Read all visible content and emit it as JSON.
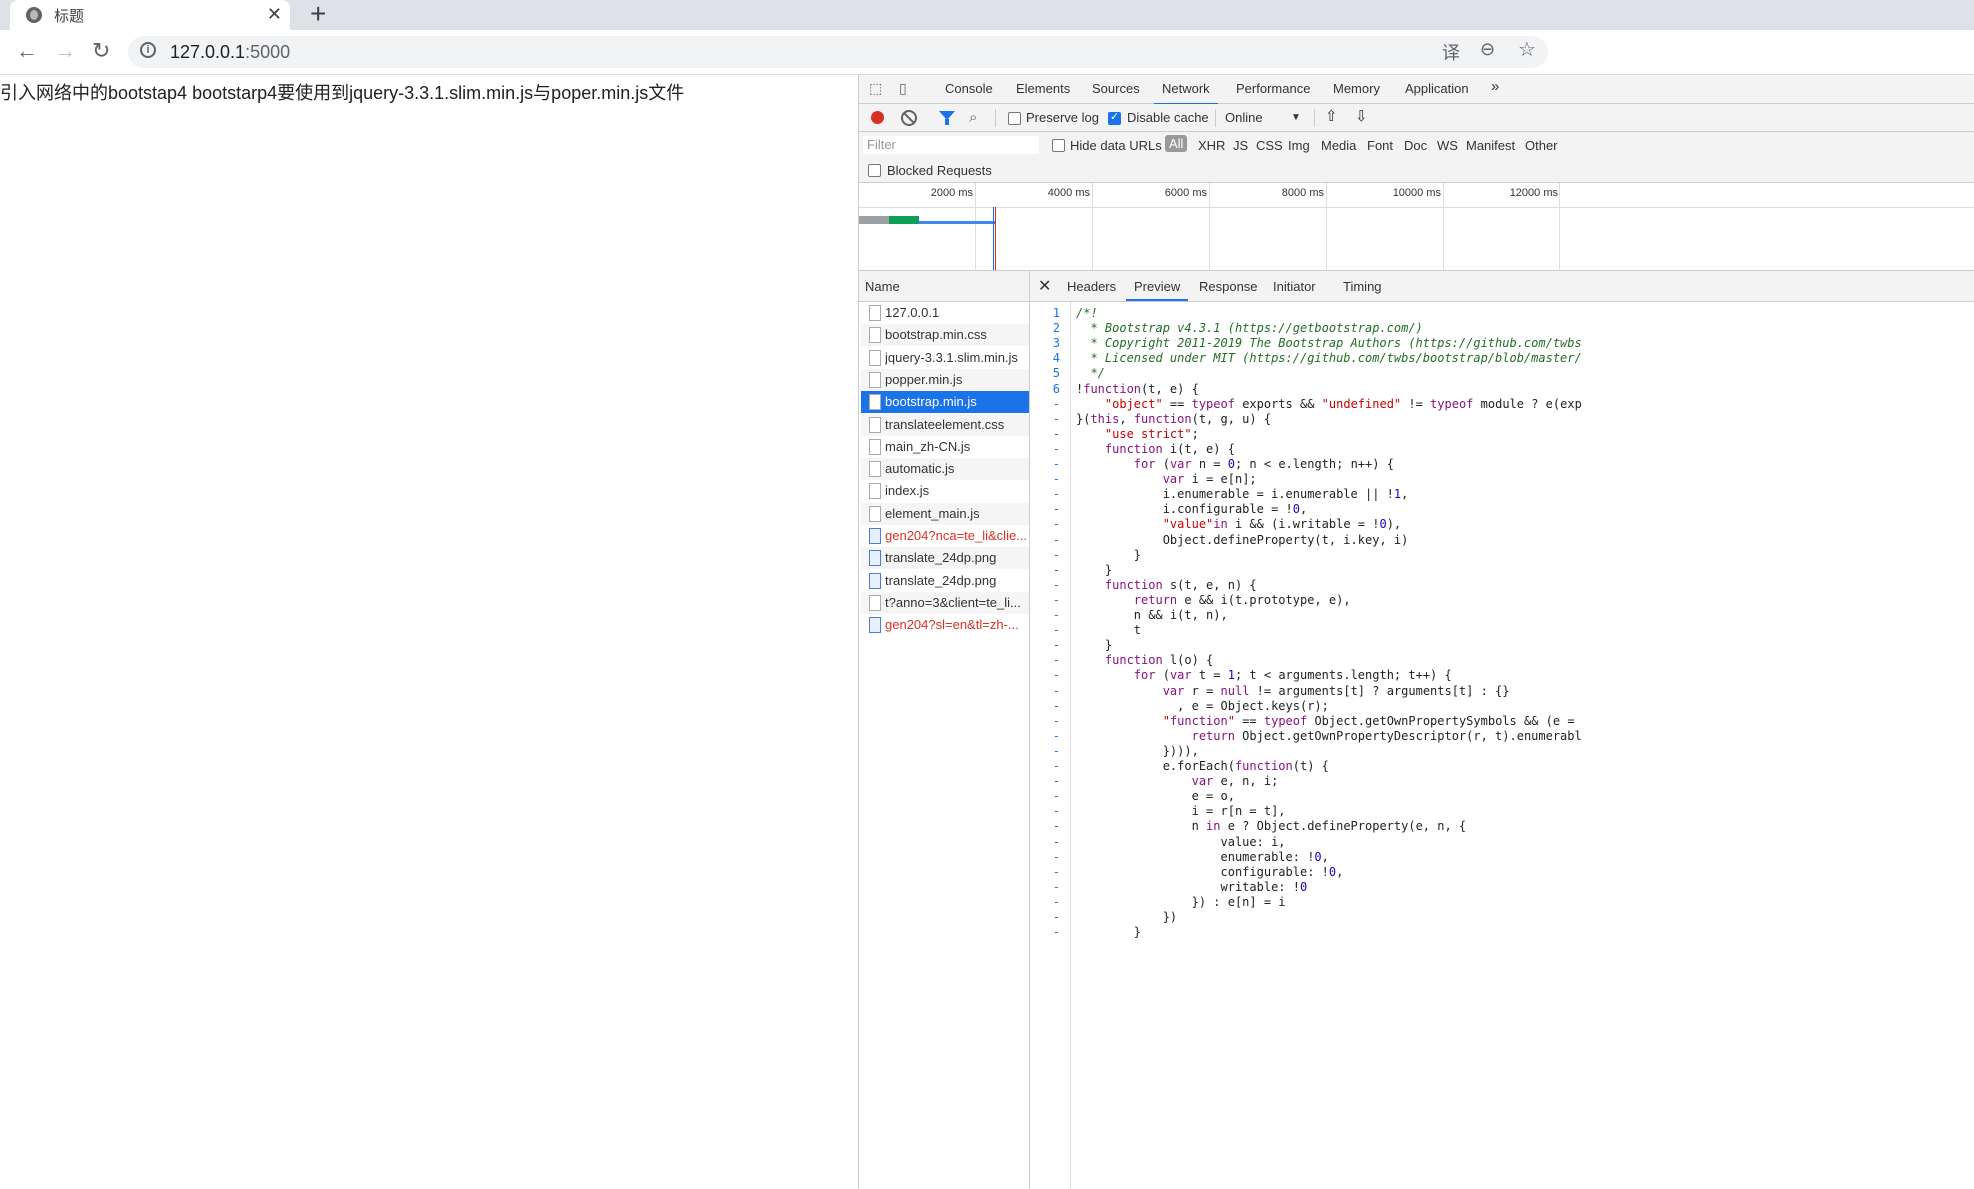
{
  "browser": {
    "tab_title": "标题",
    "tab_close": "✕",
    "new_tab": "+",
    "nav_back": "←",
    "nav_forward": "→",
    "nav_reload": "↻",
    "url_host": "127.0.0.1",
    "url_port": ":5000",
    "info_icon_glyph": "i",
    "translate_icon": "译",
    "zoom_icon": "⊖",
    "star_icon": "☆"
  },
  "page": {
    "text": "引入网络中的bootstap4 bootstarp4要使用到jquery-3.3.1.slim.min.js与poper.min.js文件"
  },
  "devtools": {
    "tabs": [
      "Console",
      "Elements",
      "Sources",
      "Network",
      "Performance",
      "Memory",
      "Application"
    ],
    "active_tab": "Network",
    "more_tabs": "»",
    "network_toolbar": {
      "preserve_log": "Preserve log",
      "disable_cache": "Disable cache",
      "throttle": "Online",
      "throttle_arrow": "▼",
      "upload_icon": "⇧",
      "download_icon": "⇩"
    },
    "filter": {
      "placeholder": "Filter",
      "hide_data_urls": "Hide data URLs",
      "types": [
        "All",
        "XHR",
        "JS",
        "CSS",
        "Img",
        "Media",
        "Font",
        "Doc",
        "WS",
        "Manifest",
        "Other"
      ],
      "blocked_requests": "Blocked Requests"
    },
    "overview_ticks": [
      "2000 ms",
      "4000 ms",
      "6000 ms",
      "8000 ms",
      "10000 ms",
      "12000 ms"
    ],
    "requests": {
      "header": "Name",
      "rows": [
        {
          "name": "127.0.0.1"
        },
        {
          "name": "bootstrap.min.css"
        },
        {
          "name": "jquery-3.3.1.slim.min.js"
        },
        {
          "name": "popper.min.js"
        },
        {
          "name": "bootstrap.min.js"
        },
        {
          "name": "translateelement.css"
        },
        {
          "name": "main_zh-CN.js"
        },
        {
          "name": "automatic.js"
        },
        {
          "name": "index.js"
        },
        {
          "name": "element_main.js"
        },
        {
          "name": "gen204?nca=te_li&clie..."
        },
        {
          "name": "translate_24dp.png"
        },
        {
          "name": "translate_24dp.png"
        },
        {
          "name": "t?anno=3&client=te_li..."
        },
        {
          "name": "gen204?sl=en&tl=zh-..."
        }
      ],
      "selected": "bootstrap.min.js"
    },
    "detail": {
      "close": "✕",
      "tabs": [
        "Headers",
        "Preview",
        "Response",
        "Initiator",
        "Timing"
      ],
      "active_tab": "Preview",
      "line_numbers": [
        "1",
        "2",
        "3",
        "4",
        "5",
        "6",
        "-",
        "-",
        "-",
        "-",
        "-",
        "-",
        "-",
        "-",
        "-",
        "-",
        "-",
        "-",
        "-",
        "-",
        "-",
        "-",
        "-",
        "-",
        "-",
        "-",
        "-",
        "-",
        "-",
        "-",
        "-",
        "-",
        "-",
        "-",
        "-",
        "-",
        "-",
        "-",
        "-",
        "-",
        "-",
        "-",
        "-"
      ],
      "code_lines": [
        "/*!",
        "  * Bootstrap v4.3.1 (https://getbootstrap.com/)",
        "  * Copyright 2011-2019 The Bootstrap Authors (https://github.com/twbs",
        "  * Licensed under MIT (https://github.com/twbs/bootstrap/blob/master/",
        "  */",
        "!function(t, e) {",
        "    \"object\" == typeof exports && \"undefined\" != typeof module ? e(exp",
        "}(this, function(t, g, u) {",
        "    \"use strict\";",
        "    function i(t, e) {",
        "        for (var n = 0; n < e.length; n++) {",
        "            var i = e[n];",
        "            i.enumerable = i.enumerable || !1,",
        "            i.configurable = !0,",
        "            \"value\"in i && (i.writable = !0),",
        "            Object.defineProperty(t, i.key, i)",
        "        }",
        "    }",
        "    function s(t, e, n) {",
        "        return e && i(t.prototype, e),",
        "        n && i(t, n),",
        "        t",
        "    }",
        "    function l(o) {",
        "        for (var t = 1; t < arguments.length; t++) {",
        "            var r = null != arguments[t] ? arguments[t] : {}",
        "              , e = Object.keys(r);",
        "            \"function\" == typeof Object.getOwnPropertySymbols && (e =",
        "                return Object.getOwnPropertyDescriptor(r, t).enumerabl",
        "            }))),",
        "            e.forEach(function(t) {",
        "                var e, n, i;",
        "                e = o,",
        "                i = r[n = t],",
        "                n in e ? Object.defineProperty(e, n, {",
        "                    value: i,",
        "                    enumerable: !0,",
        "                    configurable: !0,",
        "                    writable: !0",
        "                }) : e[n] = i",
        "            })",
        "        }"
      ]
    }
  }
}
